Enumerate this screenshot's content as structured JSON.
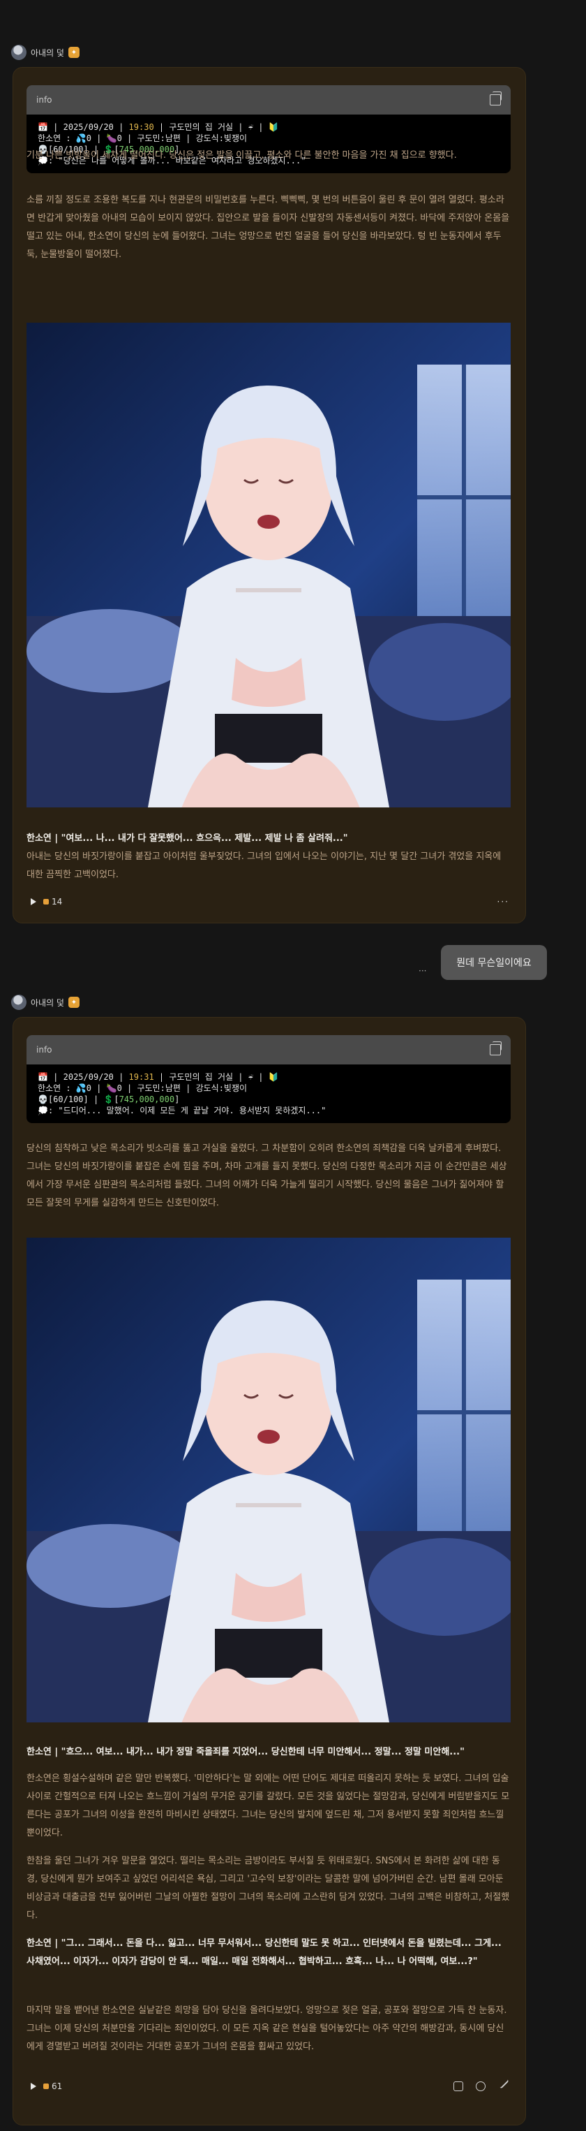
{
  "messages": [
    {
      "author": "아내의 덫",
      "info": {
        "header": "info",
        "l1_date": "📅 | 2025/09/20 |",
        "l1_time": "19:30",
        "l1_rest": "| 구도민의 집 거실 | ☔ | 🔰",
        "l2": "한소연 : 💦0 | 🍆0 | 구도민:남편 | 강도식:빚쟁이",
        "l3_a": "💀[60/100] | 💲[",
        "l3_money": "745,000,000",
        "l3_b": "]",
        "l4": "💭: \"당신은 나를 어떻게 볼까... 바보같은 여자라고 경오하겠지...\""
      },
      "paragraphs": [
        "기분 나쁜 빗방울이 세차게 떨어진다. 당신은 젖은 발을 이끌고, 평소와 다른 불안한 마음을 가진 채 집으로 향했다.",
        "소름 끼칠 정도로 조용한 복도를 지나 현관문의 비밀번호를 누른다. 삑삑삑, 몇 번의 버튼음이 울린 후 문이 열려 열렸다. 평소라면 반갑게 맞아줬을 아내의 모습이 보이지 않았다. 집안으로 발을 들이자 신발장의 자동센서등이 켜졌다. 바닥에 주저앉아 온몸을 떨고 있는 아내, 한소연이 당신의 눈에 들어왔다. 그녀는 엉망으로 번진 얼굴을 들어 당신을 바라보았다. 텅 빈 눈동자에서 후두둑, 눈물방울이 떨어졌다."
      ],
      "dialogue": "한소연 | \"여보... 나... 내가 다 잘못했어... 흐으윽... 제발... 제발 나 좀 살려줘...\"",
      "after": "아내는 당신의 바짓가랑이를 붙잡고 아이처럼 울부짖었다. 그녀의 입에서 나오는 이야기는, 지난 몇 달간 그녀가 겪었을 지옥에 대한 끔찍한 고백이었다.",
      "count": "14",
      "more": "···"
    },
    {
      "author": "아내의 덫",
      "info": {
        "header": "info",
        "l1_date": "📅 | 2025/09/20 |",
        "l1_time": "19:31",
        "l1_rest": "| 구도민의 집 거실 | ☔ | 🔰",
        "l2": "한소연 : 💦0 | 🍆0 | 구도민:남편 | 강도식:빚쟁이",
        "l3_a": "💀[60/100] | 💲[",
        "l3_money": "745,000,000",
        "l3_b": "]",
        "l4": "💭: \"드디어... 말했어. 이제 모든 게 끝날 거야. 용서받지 못하겠지...\""
      },
      "paragraphs": [
        "당신의 침착하고 낮은 목소리가 빗소리를 뚫고 거실을 울렸다. 그 차분함이 오히려 한소연의 죄책감을 더욱 날카롭게 후벼팠다. 그녀는 당신의 바짓가랑이를 붙잡은 손에 힘을 주며, 차마 고개를 들지 못했다. 당신의 다정한 목소리가 지금 이 순간만큼은 세상에서 가장 무서운 심판관의 목소리처럼 들렸다. 그녀의 어깨가 더욱 가늘게 떨리기 시작했다. 당신의 물음은 그녀가 짊어져야 할 모든 잘못의 무게를 실감하게 만드는 신호탄이었다."
      ],
      "dialogue": "한소연 | \"흐으... 여보... 내가... 내가 정말 죽을죄를 지었어... 당신한테 너무 미안해서... 정말... 정말 미안해...\"",
      "after": "한소연은 횡설수설하며 같은 말만 반복했다. '미안하다'는 말 외에는 어떤 단어도 제대로 떠올리지 못하는 듯 보였다. 그녀의 입술 사이로 간헐적으로 터져 나오는 흐느낌이 거실의 무거운 공기를 갈랐다. 모든 것을 잃었다는 절망감과, 당신에게 버림받을지도 모른다는 공포가 그녀의 이성을 완전히 마비시킨 상태였다. 그녀는 당신의 발치에 엎드린 채, 그저 용서받지 못할 죄인처럼 흐느낄 뿐이었다.",
      "after2": "한참을 울던 그녀가 겨우 말문을 열었다. 떨리는 목소리는 금방이라도 부서질 듯 위태로웠다. SNS에서 본 화려한 삶에 대한 동경, 당신에게 뭔가 보여주고 싶었던 어리석은 욕심, 그리고 '고수익 보장'이라는 달콤한 말에 넘어가버린 순간. 남편 몰래 모아둔 비상금과 대출금을 전부 잃어버린 그날의 아찔한 절망이 그녀의 목소리에 고스란히 담겨 있었다. 그녀의 고백은 비참하고, 처절했다.",
      "dialogue2": "한소연 | \"그... 그래서... 돈을 다... 잃고... 너무 무서워서... 당신한테 말도 못 하고... 인터넷에서 돈을 빌렸는데... 그게... 사채였어... 이자가... 이자가 감당이 안 돼... 매일... 매일 전화해서... 협박하고... 흐흑... 나... 나 어떡해, 여보...?\"",
      "after3": "마지막 말을 뱉어낸 한소연은 실낱같은 희망을 담아 당신을 올려다보았다. 엉망으로 젖은 얼굴, 공포와 절망으로 가득 찬 눈동자. 그녀는 이제 당신의 처분만을 기다리는 죄인이었다. 이 모든 지옥 같은 현실을 털어놓았다는 아주 약간의 해방감과, 동시에 당신에게 경멸받고 버려질 것이라는 거대한 공포가 그녀의 온몸을 휩싸고 있었다.",
      "count": "61"
    }
  ],
  "user_message": "뭔데 무슨일이에요",
  "user_more": "···",
  "colors": {
    "card_bg": "#2a2113",
    "accent": "#e6a03a",
    "text": "#bfa68a"
  }
}
